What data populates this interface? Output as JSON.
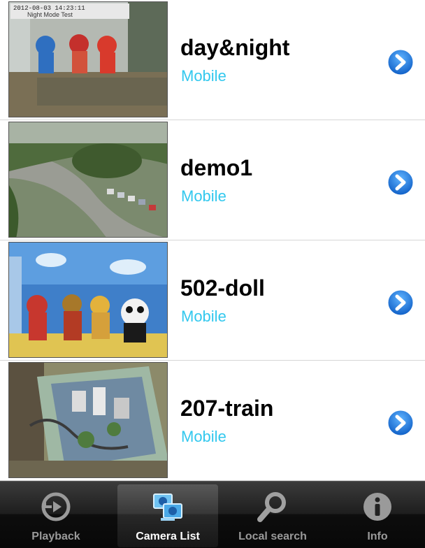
{
  "cameras": [
    {
      "name": "day&night",
      "type": "Mobile",
      "overlay_text": "Night Mode Test"
    },
    {
      "name": "demo1",
      "type": "Mobile"
    },
    {
      "name": "502-doll",
      "type": "Mobile"
    },
    {
      "name": "207-train",
      "type": "Mobile"
    }
  ],
  "tabbar": {
    "tabs": [
      {
        "label": "Playback",
        "icon": "playback-icon",
        "active": false
      },
      {
        "label": "Camera List",
        "icon": "camera-list-icon",
        "active": true
      },
      {
        "label": "Local search",
        "icon": "search-icon",
        "active": false
      },
      {
        "label": "Info",
        "icon": "info-icon",
        "active": false
      }
    ]
  },
  "colors": {
    "subtitle": "#32c8ee",
    "disclosure_button": "#1e7fd8",
    "tab_active_label": "#ffffff",
    "tab_inactive_label": "#9a9a9a"
  }
}
